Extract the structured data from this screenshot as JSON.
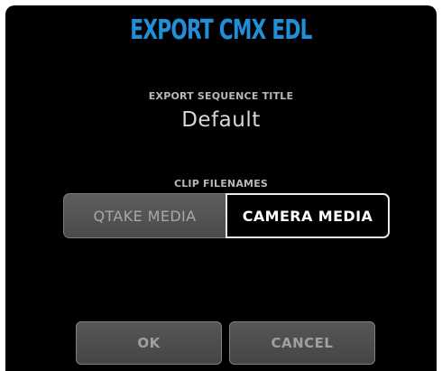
{
  "dialog": {
    "title": "EXPORT CMX EDL",
    "title_color": "#1f8fd8",
    "sequence_title_label": "EXPORT SEQUENCE TITLE",
    "sequence_title_value": "Default",
    "clip_filenames_label": "CLIP FILENAMES",
    "clip_filenames_options": [
      {
        "label": "QTAKE MEDIA",
        "selected": false
      },
      {
        "label": "CAMERA MEDIA",
        "selected": true
      }
    ],
    "ok_label": "OK",
    "cancel_label": "CANCEL"
  }
}
